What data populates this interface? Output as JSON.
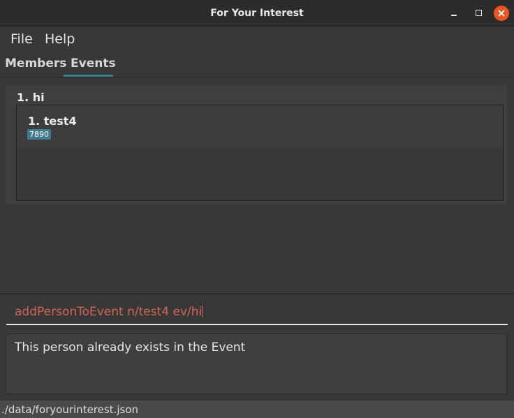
{
  "window": {
    "title": "For Your Interest",
    "close_glyph": "×"
  },
  "menu": {
    "file": "File",
    "help": "Help"
  },
  "tabs": {
    "members": "Members",
    "events": "Events",
    "active": "Events"
  },
  "events": [
    {
      "index_title": "1.  hi",
      "members": [
        {
          "index_name": "1.  test4",
          "tag": "7890"
        }
      ]
    }
  ],
  "command": {
    "value": "addPersonToEvent n/test4 ev/hi"
  },
  "result": {
    "message": "This person already exists in the Event"
  },
  "status": {
    "path": "./data/foryourinterest.json"
  },
  "colors": {
    "accent": "#3e7b91",
    "command_text": "#d06651",
    "close_button": "#e95420"
  }
}
